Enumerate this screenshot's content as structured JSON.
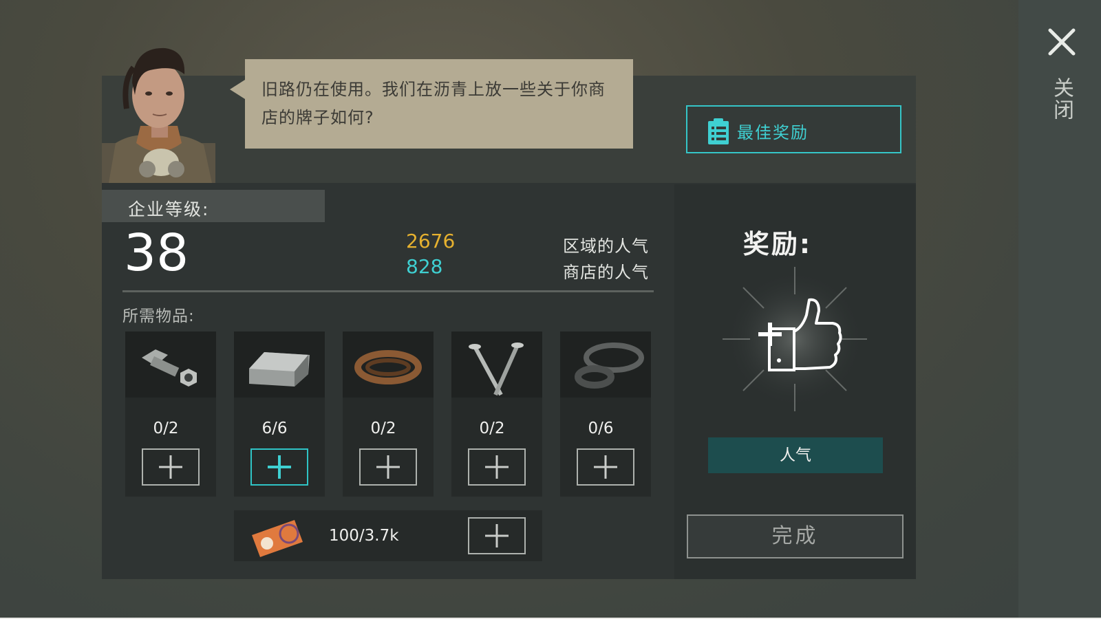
{
  "close": {
    "label": "关闭"
  },
  "dialog": {
    "text": "旧路仍在使用。我们在沥青上放一些关于你商店的牌子如何?"
  },
  "best_reward": {
    "label": "最佳奖励"
  },
  "enterprise": {
    "level_label": "企业等级:",
    "level": "38",
    "area_popularity": "2676",
    "shop_popularity": "828",
    "area_popularity_label": "区域的人气",
    "shop_popularity_label": "商店的人气"
  },
  "requirements": {
    "label": "所需物品:",
    "items": [
      {
        "icon": "bolt-nut-icon",
        "count": "0/2",
        "complete": false
      },
      {
        "icon": "metal-ingot-icon",
        "count": "6/6",
        "complete": true
      },
      {
        "icon": "leather-strap-icon",
        "count": "0/2",
        "complete": false
      },
      {
        "icon": "nails-icon",
        "count": "0/2",
        "complete": false
      },
      {
        "icon": "rubber-gasket-icon",
        "count": "0/6",
        "complete": false
      }
    ],
    "ticket": {
      "icon": "coupon-ticket-icon",
      "count": "100/3.7k"
    }
  },
  "reward": {
    "title": "奖励:",
    "icon": "popularity-thumbs-up-icon",
    "badge": "人气",
    "complete_label": "完成"
  },
  "colors": {
    "accent_cyan": "#3fd0d2",
    "accent_yellow": "#e6b12f",
    "panel_dark": "#2f3433"
  }
}
